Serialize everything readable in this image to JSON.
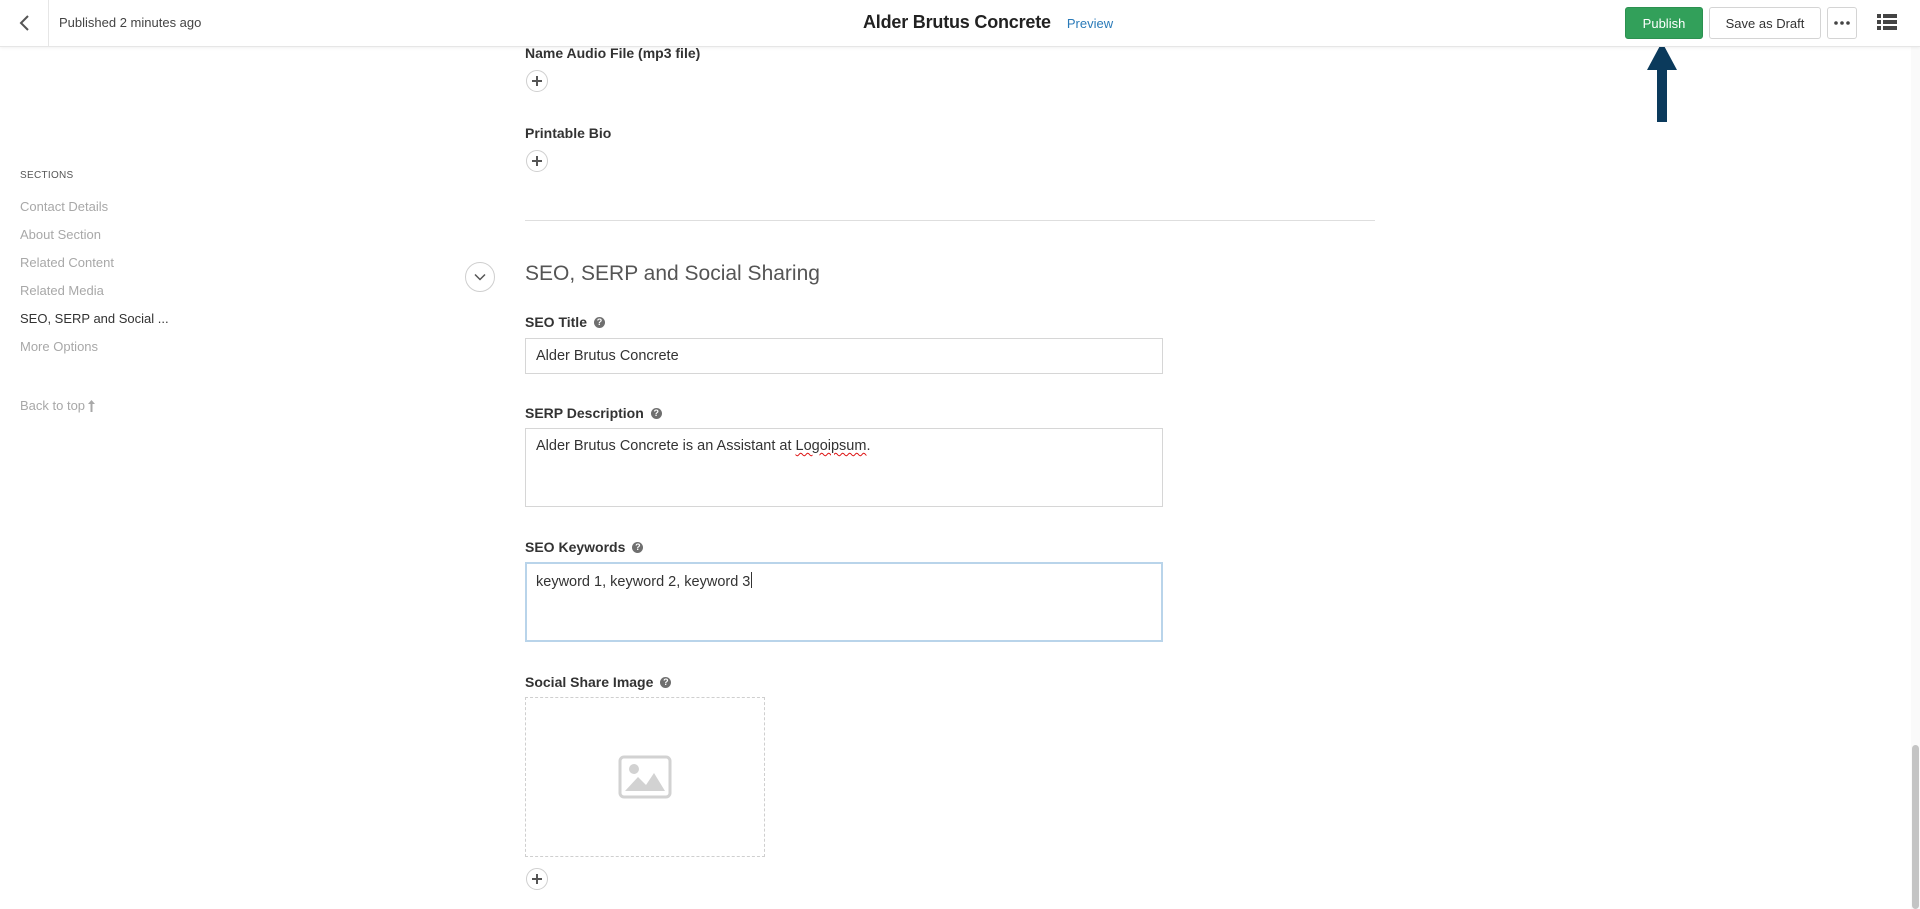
{
  "topbar": {
    "status": "Published 2 minutes ago",
    "title": "Alder Brutus Concrete",
    "preview_label": "Preview",
    "publish_label": "Publish",
    "save_draft_label": "Save as Draft"
  },
  "sidebar": {
    "heading": "SECTIONS",
    "items": [
      {
        "label": "Contact Details",
        "active": false
      },
      {
        "label": "About Section",
        "active": false
      },
      {
        "label": "Related Content",
        "active": false
      },
      {
        "label": "Related Media",
        "active": false
      },
      {
        "label": "SEO, SERP and Social ...",
        "active": true
      },
      {
        "label": "More Options",
        "active": false
      }
    ],
    "back_to_top": "Back to top"
  },
  "fields": {
    "name_audio_label": "Name Audio File (mp3 file)",
    "printable_bio_label": "Printable Bio"
  },
  "seo_section": {
    "title": "SEO, SERP and Social Sharing",
    "seo_title": {
      "label": "SEO Title",
      "value": "Alder Brutus Concrete"
    },
    "serp_description": {
      "label": "SERP Description",
      "value_prefix": "Alder Brutus Concrete is an Assistant at ",
      "value_misspelled": "Logoipsum",
      "value_suffix": "."
    },
    "seo_keywords": {
      "label": "SEO Keywords",
      "value": "keyword 1, keyword 2, keyword 3"
    },
    "social_share_image": {
      "label": "Social Share Image"
    }
  },
  "colors": {
    "publish_green": "#32a05a",
    "preview_link": "#2a7ab8",
    "annotation_arrow": "#0b3a5c"
  },
  "icons": [
    "back-arrow-icon",
    "more-dots-icon",
    "list-view-icon",
    "plus-icon",
    "chevron-down-icon",
    "help-icon",
    "image-placeholder-icon",
    "arrow-up-icon"
  ]
}
